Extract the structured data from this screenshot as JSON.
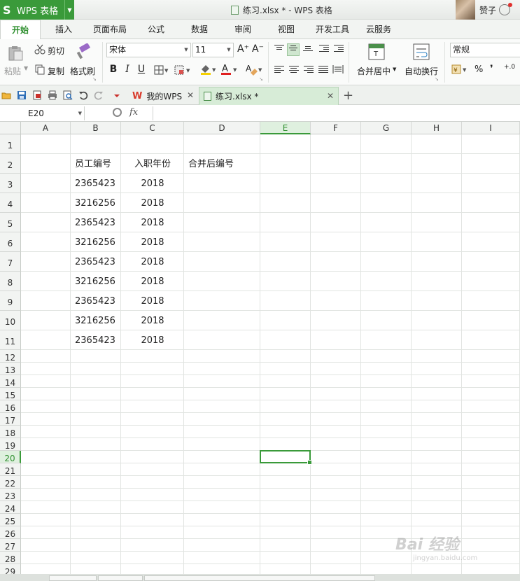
{
  "app": {
    "logo_glyph": "S",
    "name": "WPS 表格",
    "title": "练习.xlsx * - WPS 表格",
    "accent": "#3a9a3a"
  },
  "user": {
    "name": "赞子"
  },
  "menu_tabs": [
    "开始",
    "插入",
    "页面布局",
    "公式",
    "数据",
    "审阅",
    "视图",
    "开发工具",
    "云服务"
  ],
  "ribbon": {
    "paste": "粘贴",
    "cut": "剪切",
    "copy": "复制",
    "format_painter": "格式刷",
    "font_name": "宋体",
    "font_size": "11",
    "grow": "A⁺",
    "shrink": "A⁻",
    "bold": "B",
    "italic": "I",
    "underline": "U",
    "merge_center": "合并居中",
    "wrap_text": "自动换行",
    "number_format": "常规",
    "percent": "%",
    "thousands": "❜",
    "decimal": "+.0"
  },
  "doc_tabs": [
    {
      "label": "我的WPS"
    },
    {
      "label": "练习.xlsx *"
    }
  ],
  "formula_bar": {
    "name_box": "E20",
    "fx": "fx",
    "content": ""
  },
  "columns": [
    "A",
    "B",
    "C",
    "D",
    "E",
    "F",
    "G",
    "H",
    "I"
  ],
  "rows": [
    "1",
    "2",
    "3",
    "4",
    "5",
    "6",
    "7",
    "8",
    "9",
    "10",
    "11",
    "12",
    "13",
    "14",
    "15",
    "16",
    "17",
    "18",
    "19",
    "20",
    "21",
    "22",
    "23",
    "24",
    "25",
    "26",
    "27",
    "28",
    "29"
  ],
  "headers": {
    "b2": "员工编号",
    "c2": "入职年份",
    "d2": "合并后编号"
  },
  "data_rows": [
    [
      "2365423",
      "2018"
    ],
    [
      "3216256",
      "2018"
    ],
    [
      "2365423",
      "2018"
    ],
    [
      "3216256",
      "2018"
    ],
    [
      "2365423",
      "2018"
    ],
    [
      "3216256",
      "2018"
    ],
    [
      "2365423",
      "2018"
    ],
    [
      "3216256",
      "2018"
    ],
    [
      "2365423",
      "2018"
    ]
  ],
  "selected_cell": "E20",
  "watermark": {
    "text": "Bai 经验",
    "sub": "jingyan.baidu.com"
  }
}
